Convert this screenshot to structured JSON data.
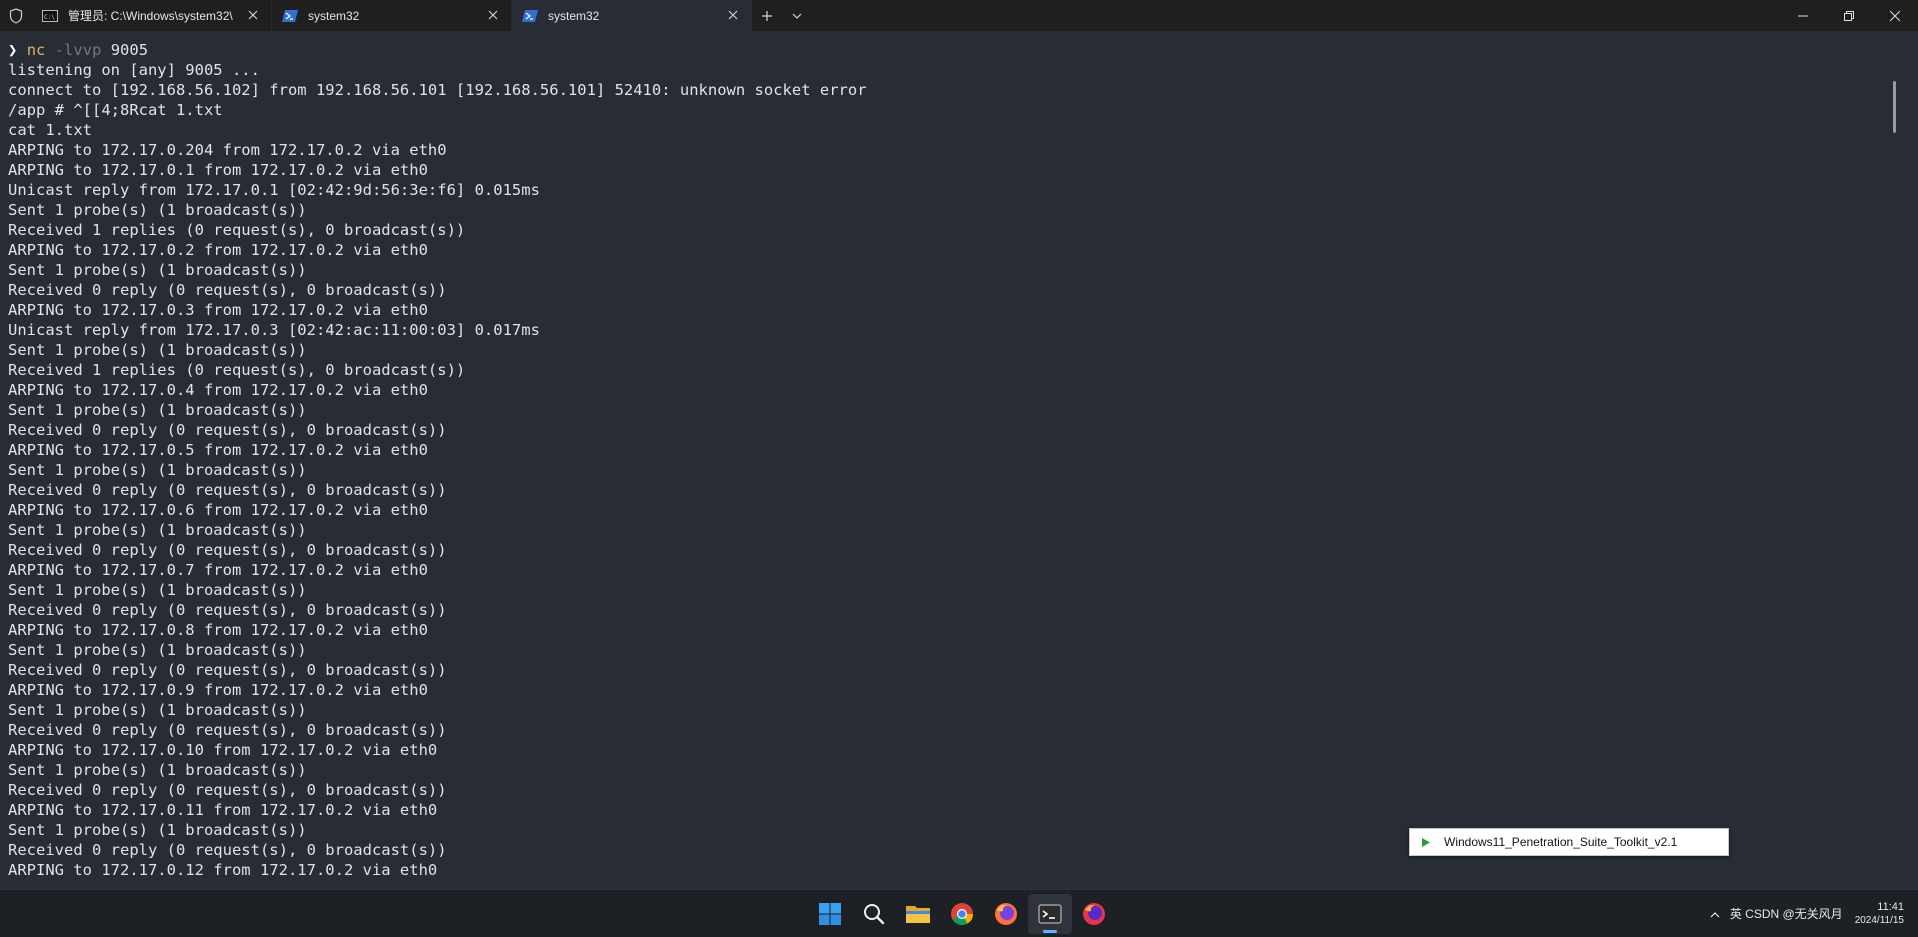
{
  "tabs": [
    {
      "label": "管理员: C:\\Windows\\system32\\",
      "icon": "cmd-icon"
    },
    {
      "label": "system32",
      "icon": "powershell-icon"
    },
    {
      "label": "system32",
      "icon": "powershell-icon"
    }
  ],
  "active_tab": 2,
  "terminal": {
    "prompt_symbol": "❯",
    "command": "nc",
    "flags": "-lvvp",
    "port": "9005",
    "lines": [
      "listening on [any] 9005 ...",
      "connect to [192.168.56.102] from 192.168.56.101 [192.168.56.101] 52410: unknown socket error",
      "/app # ^[[4;8Rcat 1.txt",
      "cat 1.txt",
      "ARPING to 172.17.0.204 from 172.17.0.2 via eth0",
      "ARPING to 172.17.0.1 from 172.17.0.2 via eth0",
      "Unicast reply from 172.17.0.1 [02:42:9d:56:3e:f6] 0.015ms",
      "Sent 1 probe(s) (1 broadcast(s))",
      "Received 1 replies (0 request(s), 0 broadcast(s))",
      "ARPING to 172.17.0.2 from 172.17.0.2 via eth0",
      "Sent 1 probe(s) (1 broadcast(s))",
      "Received 0 reply (0 request(s), 0 broadcast(s))",
      "ARPING to 172.17.0.3 from 172.17.0.2 via eth0",
      "Unicast reply from 172.17.0.3 [02:42:ac:11:00:03] 0.017ms",
      "Sent 1 probe(s) (1 broadcast(s))",
      "Received 1 replies (0 request(s), 0 broadcast(s))",
      "ARPING to 172.17.0.4 from 172.17.0.2 via eth0",
      "Sent 1 probe(s) (1 broadcast(s))",
      "Received 0 reply (0 request(s), 0 broadcast(s))",
      "ARPING to 172.17.0.5 from 172.17.0.2 via eth0",
      "Sent 1 probe(s) (1 broadcast(s))",
      "Received 0 reply (0 request(s), 0 broadcast(s))",
      "ARPING to 172.17.0.6 from 172.17.0.2 via eth0",
      "Sent 1 probe(s) (1 broadcast(s))",
      "Received 0 reply (0 request(s), 0 broadcast(s))",
      "ARPING to 172.17.0.7 from 172.17.0.2 via eth0",
      "Sent 1 probe(s) (1 broadcast(s))",
      "Received 0 reply (0 request(s), 0 broadcast(s))",
      "ARPING to 172.17.0.8 from 172.17.0.2 via eth0",
      "Sent 1 probe(s) (1 broadcast(s))",
      "Received 0 reply (0 request(s), 0 broadcast(s))",
      "ARPING to 172.17.0.9 from 172.17.0.2 via eth0",
      "Sent 1 probe(s) (1 broadcast(s))",
      "Received 0 reply (0 request(s), 0 broadcast(s))",
      "ARPING to 172.17.0.10 from 172.17.0.2 via eth0",
      "Sent 1 probe(s) (1 broadcast(s))",
      "Received 0 reply (0 request(s), 0 broadcast(s))",
      "ARPING to 172.17.0.11 from 172.17.0.2 via eth0",
      "Sent 1 probe(s) (1 broadcast(s))",
      "Received 0 reply (0 request(s), 0 broadcast(s))",
      "ARPING to 172.17.0.12 from 172.17.0.2 via eth0"
    ]
  },
  "popup": {
    "label": "Windows11_Penetration_Suite_Toolkit_v2.1",
    "icon": "play-icon"
  },
  "taskbar": {
    "apps": [
      "windows-start-icon",
      "search-icon",
      "file-explorer-icon",
      "chrome-icon",
      "firefox-icon",
      "terminal-icon",
      "firefox-dev-icon"
    ],
    "active_app": "terminal-icon",
    "tray_text": "英 CSDN @无关风月",
    "time": "11:41",
    "date": "2024/11/15"
  },
  "colors": {
    "terminal_bg": "#282c34",
    "titlebar_bg": "#1f1f1f",
    "taskbar_bg": "#1d2025",
    "command": "#d8b36a",
    "flag": "#6f7680"
  }
}
